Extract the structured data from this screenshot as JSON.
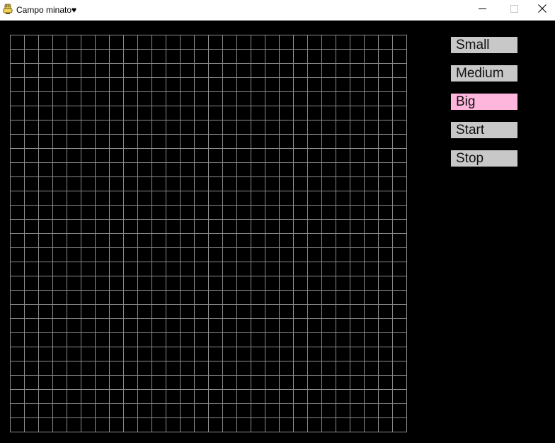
{
  "window": {
    "title": "Campo minato♥",
    "app_icon": "python-snake-icon"
  },
  "board": {
    "rows": 28,
    "cols": 28,
    "grid_line_color": "#8c8c8c",
    "background": "#000000"
  },
  "buttons": [
    {
      "label": "Small",
      "selected": false,
      "color": "#c8c8c8"
    },
    {
      "label": "Medium",
      "selected": false,
      "color": "#c8c8c8"
    },
    {
      "label": "Big",
      "selected": true,
      "color": "#ffb6dd"
    },
    {
      "label": "Start",
      "selected": false,
      "color": "#c8c8c8"
    },
    {
      "label": "Stop",
      "selected": false,
      "color": "#c8c8c8"
    }
  ]
}
